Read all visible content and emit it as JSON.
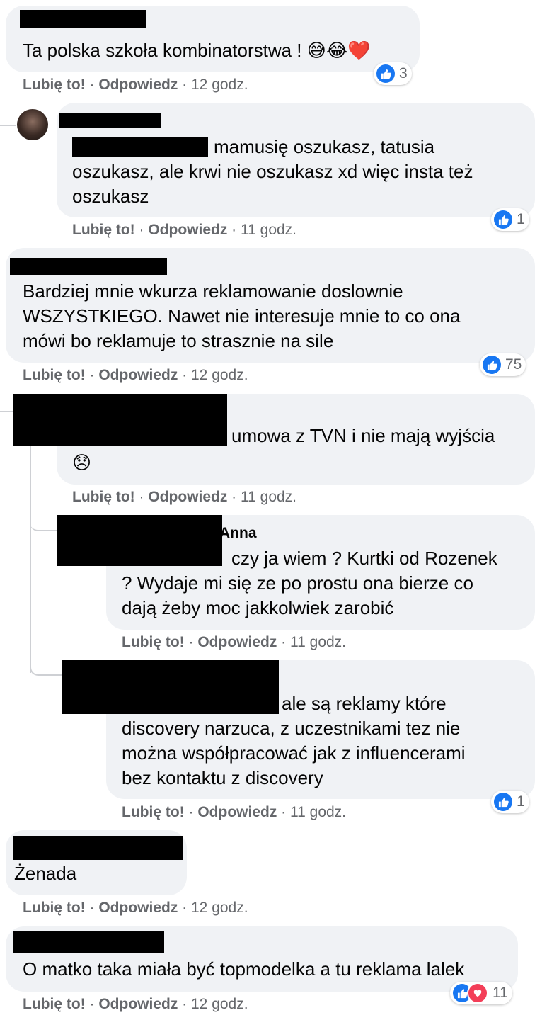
{
  "comments": [
    {
      "text": "Ta polska szkoła kombinatorstwa ! 😅😂❤️",
      "actions": {
        "like": "Lubię to!",
        "sep1": " · ",
        "reply": "Odpowiedz",
        "sep2": " · ",
        "time": "12 godz."
      },
      "reactions": {
        "count": "3",
        "icons": [
          "like-icon"
        ]
      }
    },
    {
      "text": "mamusię oszukasz, tatusia oszukasz, ale krwi nie oszukasz xd więc insta też oszukasz",
      "line1": "mamusię oszukasz, tatusia",
      "line2": "oszukasz, ale krwi nie oszukasz xd więc insta też",
      "line3": "oszukasz",
      "actions": {
        "like": "Lubię to!",
        "sep1": " · ",
        "reply": "Odpowiedz",
        "sep2": " · ",
        "time": "11 godz."
      },
      "reactions": {
        "count": "1",
        "icons": [
          "like-icon"
        ]
      }
    },
    {
      "line1": "Bardziej mnie wkurza reklamowanie doslownie",
      "line2": "WSZYSTKIEGO. Nawet nie interesuje mnie to co ona",
      "line3": "mówi bo reklamuje to strasznie na sile",
      "actions": {
        "like": "Lubię to!",
        "sep1": " · ",
        "reply": "Odpowiedz",
        "sep2": " · ",
        "time": "12 godz."
      },
      "reactions": {
        "count": "75",
        "icons": [
          "like-icon"
        ]
      }
    },
    {
      "line1": "umowa z TVN i nie mają wyjścia",
      "line2": "😞",
      "actions": {
        "like": "Lubię to!",
        "sep1": " · ",
        "reply": "Odpowiedz",
        "sep2": " · ",
        "time": "11 godz."
      }
    },
    {
      "name_fragment": "Anna",
      "line1": "czy ja wiem ? Kurtki od Rozenek",
      "line2": "? Wydaje mi się ze po prostu ona bierze co",
      "line3": "dają żeby moc jakkolwiek zarobić",
      "actions": {
        "like": "Lubię to!",
        "sep1": " · ",
        "reply": "Odpowiedz",
        "sep2": " · ",
        "time": "11 godz."
      }
    },
    {
      "line1": "ale są reklamy które",
      "line2": "discovery narzuca, z uczestnikami tez nie",
      "line3": "można współpracować jak z influencerami",
      "line4": "bez kontaktu z discovery",
      "actions": {
        "like": "Lubię to!",
        "sep1": " · ",
        "reply": "Odpowiedz",
        "sep2": " · ",
        "time": "11 godz."
      },
      "reactions": {
        "count": "1",
        "icons": [
          "like-icon"
        ]
      }
    },
    {
      "line1": "Żenada",
      "actions": {
        "like": "Lubię to!",
        "sep1": " · ",
        "reply": "Odpowiedz",
        "sep2": " · ",
        "time": "12 godz."
      }
    },
    {
      "line1": "O matko taka miała być topmodelka a tu reklama lalek",
      "actions": {
        "like": "Lubię to!",
        "sep1": " · ",
        "reply": "Odpowiedz",
        "sep2": " · ",
        "time": "12 godz."
      },
      "reactions": {
        "count": "11",
        "icons": [
          "like-icon",
          "heart-icon"
        ]
      }
    }
  ],
  "colors": {
    "bubble": "#f0f2f5",
    "like": "#1877f2",
    "heart": "#f33e58",
    "meta": "#65676b"
  }
}
